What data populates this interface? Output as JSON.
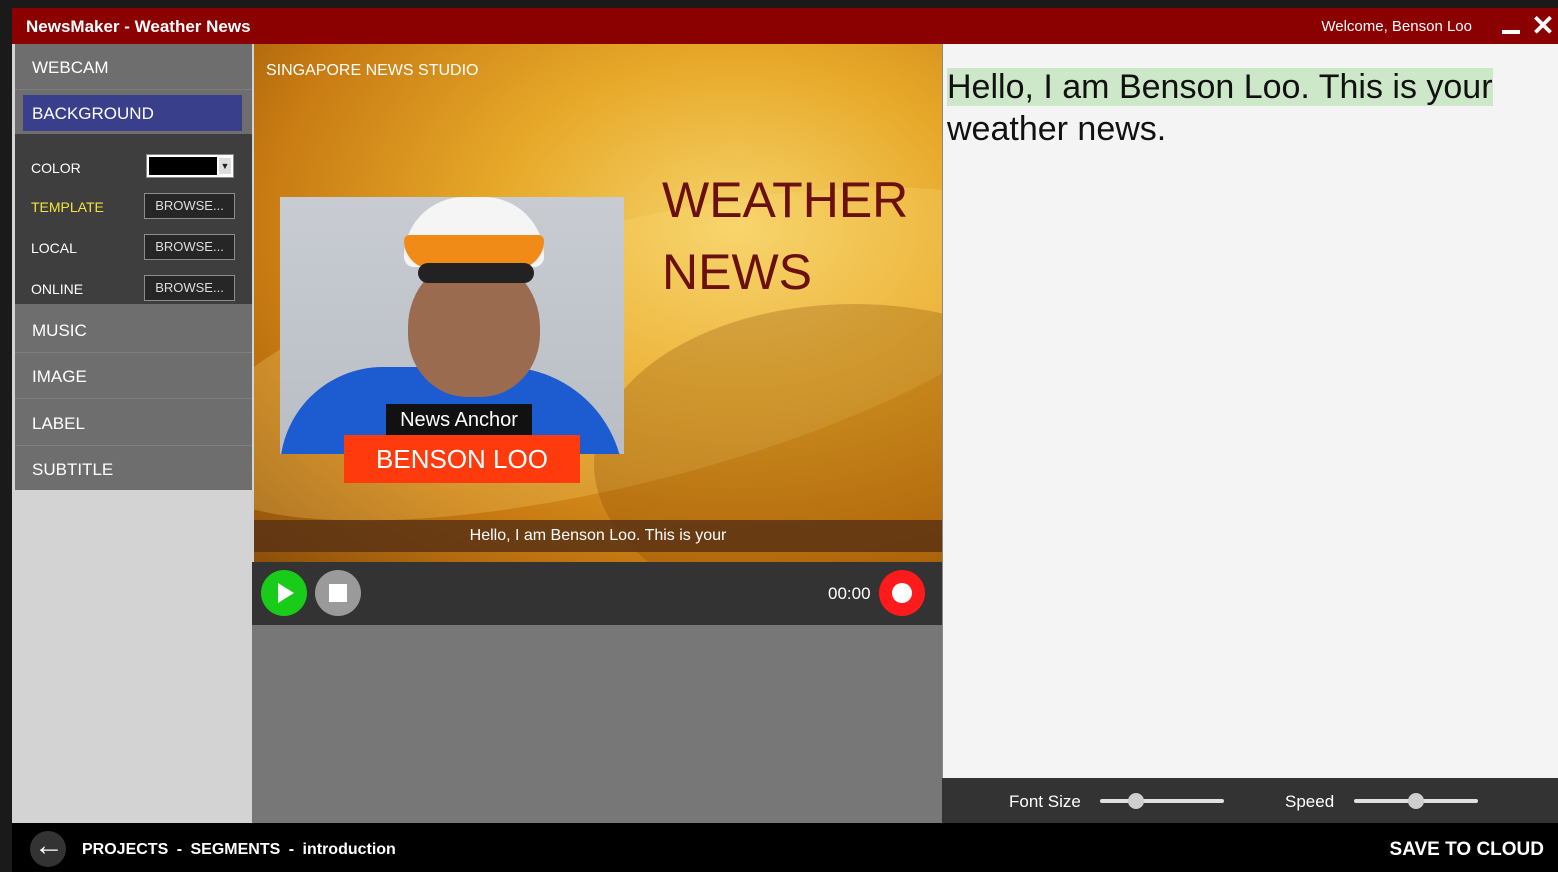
{
  "titlebar": {
    "title": "NewsMaker - Weather News",
    "welcome": "Welcome,  Benson Loo",
    "close_glyph": "✕"
  },
  "sidebar": {
    "items": [
      {
        "label": "WEBCAM"
      },
      {
        "label": "BACKGROUND"
      },
      {
        "label": "MUSIC"
      },
      {
        "label": "IMAGE"
      },
      {
        "label": "LABEL"
      },
      {
        "label": "SUBTITLE"
      }
    ],
    "background_panel": {
      "color_label": "COLOR",
      "color_value": "#000000",
      "template_label": "TEMPLATE",
      "local_label": "LOCAL",
      "online_label": "ONLINE",
      "browse_label": "BROWSE..."
    }
  },
  "stage": {
    "studio": "SINGAPORE NEWS STUDIO",
    "headline_1": "WEATHER",
    "headline_2": "NEWS",
    "anchor_title": "News Anchor",
    "anchor_name": "BENSON LOO",
    "subtitle": "Hello, I am Benson Loo. This is your"
  },
  "controls": {
    "timer": "00:00"
  },
  "script": {
    "highlighted": "Hello, I am Benson Loo. This is your",
    "rest": "weather news."
  },
  "sliders": {
    "font_size_label": "Font Size",
    "font_size_level": 0.26,
    "speed_label": "Speed",
    "speed_level": 0.5
  },
  "footer": {
    "breadcrumb": [
      "PROJECTS",
      "-",
      "SEGMENTS",
      "-",
      "introduction"
    ],
    "save_label": "SAVE TO CLOUD"
  },
  "colors": {
    "titlebar": "#8b0000",
    "active_menu": "#3a3f8c",
    "anchor_name_bg": "#ff3b0e",
    "play": "#19cc19",
    "record": "#ff1b1b",
    "script_highlight": "#cde8c8",
    "template_label": "#f4e33a"
  }
}
